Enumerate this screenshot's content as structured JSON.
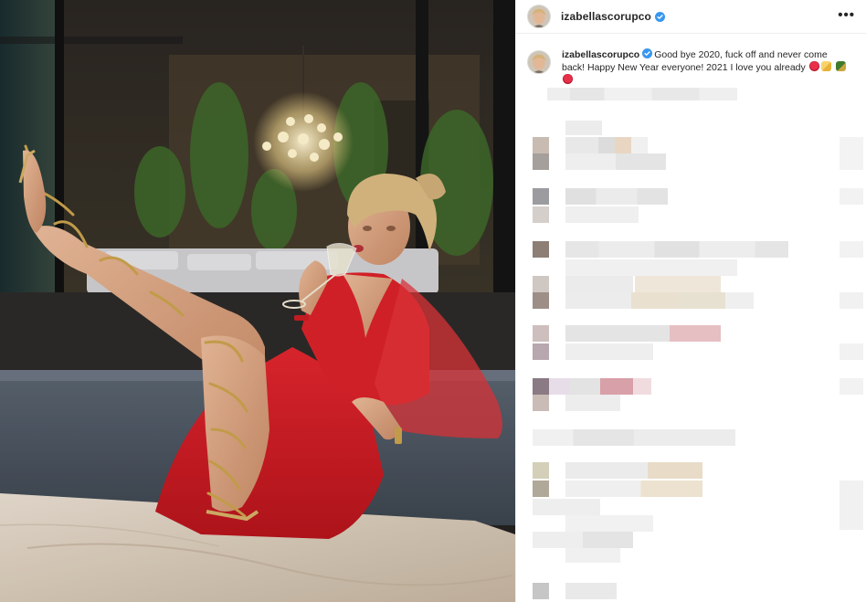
{
  "post": {
    "username": "izabellascorupco",
    "verified": true,
    "more_label": "•••"
  },
  "caption": {
    "username": "izabellascorupco",
    "text": "Good bye 2020, fuck off and never come back! Happy New Year everyone! 2021 I love you already",
    "emojis": [
      "kiss-lips-emoji",
      "cheers-emoji",
      "champagne-bottle-emoji",
      "kiss-lips-emoji"
    ]
  },
  "photo": {
    "subject": "photo",
    "dress_color": "#d8242c"
  },
  "colors": {
    "border": "#efefef",
    "text": "#262626",
    "verified_blue": "#3897f0",
    "pixel_gray": "#e4e4e4"
  },
  "comments": {
    "redacted": true
  }
}
